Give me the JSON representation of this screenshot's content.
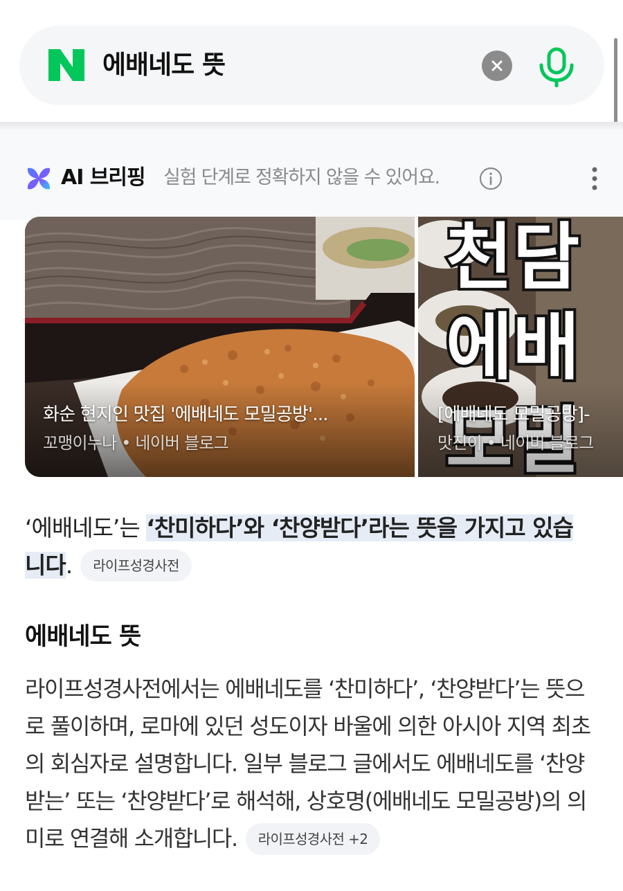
{
  "search": {
    "query": "에배네도 뜻",
    "brand_color": "#03c75a"
  },
  "ai_briefing": {
    "title": "AI 브리핑",
    "disclaimer": "실험 단계로 정확하지 않을 수 있어요."
  },
  "cards": [
    {
      "title": "화순 현지인 맛집 '에배네도 모밀공방'...",
      "source": "꼬맹이누나 • 네이버 블로그"
    },
    {
      "title": "[에배네도 모밀공방]-",
      "source": "맛진이 • 네이버 블로그"
    }
  ],
  "summary": {
    "prefix": "‘에배네도’는 ",
    "highlight_1": "‘찬미하다’와 ‘찬양받다’라는 뜻을 가지고 있습",
    "highlight_2": "니다",
    "suffix": ".",
    "source_chip": "라이프성경사전"
  },
  "section": {
    "title": "에배네도 뜻",
    "body": "라이프성경사전에서는 에배네도를 ‘찬미하다’, ‘찬양받다’는 뜻으로 풀이하며, 로마에 있던 성도이자 바울에 의한 아시아 지역 최초의 회심자로 설명합니다. 일부 블로그 글에서도 에배네도를 ‘찬양받는’ 또는 ‘찬양받다’로 해석해, 상호명(에배네도 모밀공방)의 의미로 연결해 소개합니다.",
    "source_chip": "라이프성경사전 +2"
  }
}
